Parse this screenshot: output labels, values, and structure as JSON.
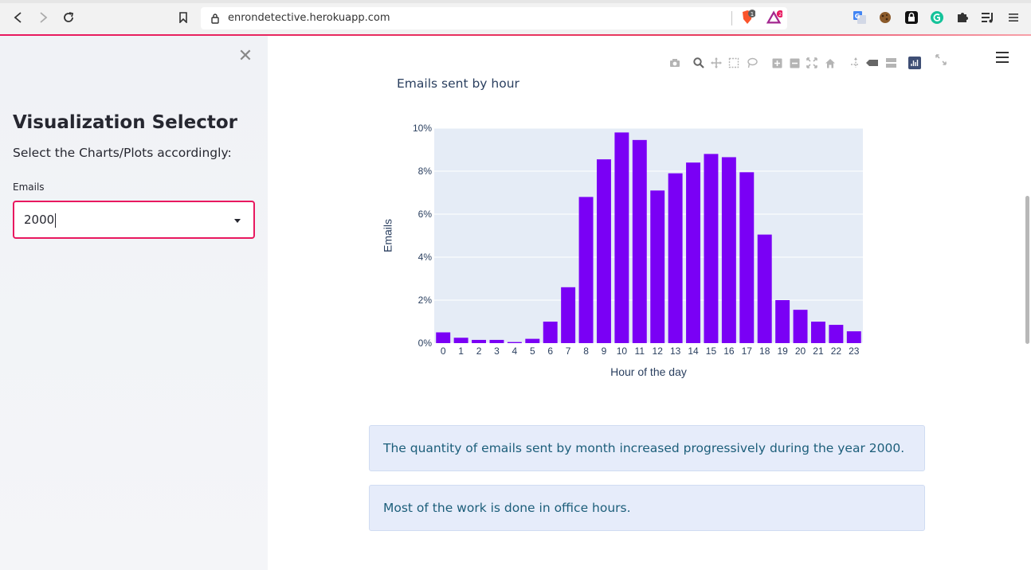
{
  "browser": {
    "url": "enrondetective.herokuapp.com",
    "extension_badges": [
      "1",
      "2"
    ]
  },
  "sidebar": {
    "title": "Visualization Selector",
    "subtitle": "Select the Charts/Plots accordingly:",
    "select_label": "Emails",
    "select_value": "2000"
  },
  "chart": {
    "title": "Emails sent by hour",
    "xlabel": "Hour of the day",
    "ylabel": "Emails"
  },
  "colors": {
    "bar": "#7a00f5",
    "plot_bg": "#e5ecf6",
    "accent": "#e8185f",
    "title_text": "#2a3f5f"
  },
  "chart_data": {
    "type": "bar",
    "title": "Emails sent by hour",
    "xlabel": "Hour of the day",
    "ylabel": "Emails",
    "categories": [
      "0",
      "1",
      "2",
      "3",
      "4",
      "5",
      "6",
      "7",
      "8",
      "9",
      "10",
      "11",
      "12",
      "13",
      "14",
      "15",
      "16",
      "17",
      "18",
      "19",
      "20",
      "21",
      "22",
      "23"
    ],
    "values": [
      0.5,
      0.25,
      0.15,
      0.15,
      0.05,
      0.2,
      1.0,
      2.6,
      6.8,
      8.55,
      9.8,
      9.45,
      7.1,
      7.9,
      8.4,
      8.8,
      8.65,
      7.95,
      5.05,
      2.0,
      1.55,
      1.0,
      0.85,
      0.55
    ],
    "yticks": [
      "0%",
      "2%",
      "4%",
      "6%",
      "8%",
      "10%"
    ],
    "ylim": [
      0,
      10
    ],
    "grid": true,
    "legend": "none"
  },
  "insights": [
    "The quantity of emails sent by month increased progressively during the year 2000.",
    "Most of the work is done in office hours."
  ]
}
